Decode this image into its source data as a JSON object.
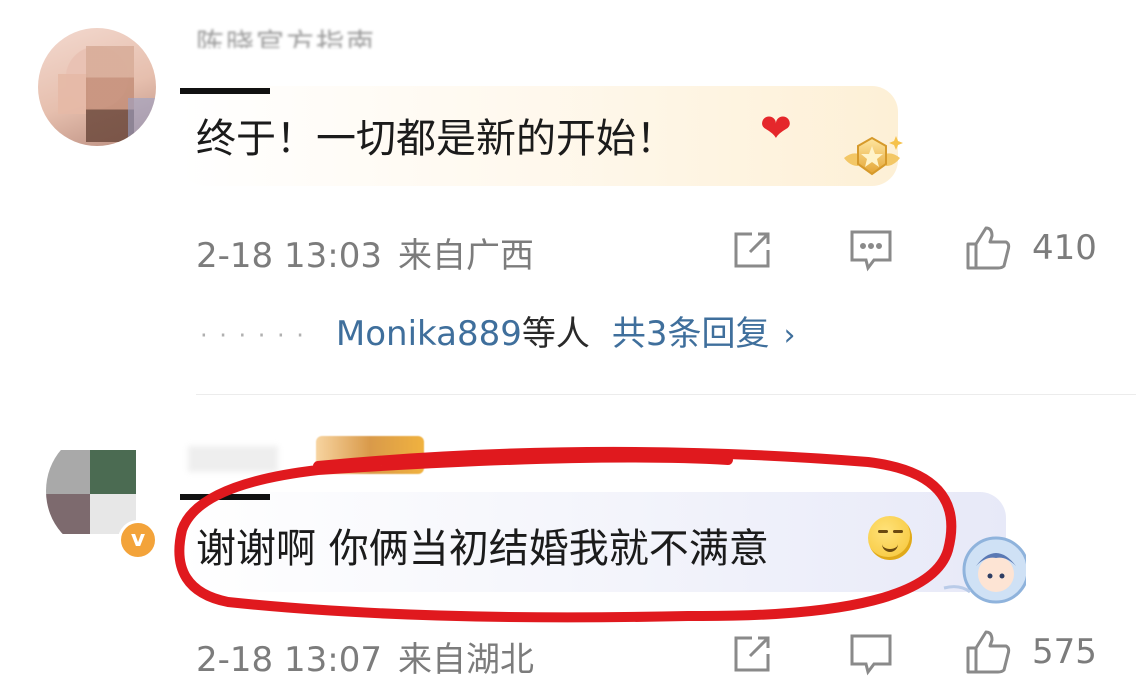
{
  "comments": [
    {
      "username": "陈晓官方指南",
      "text": "终于！一切都是新的开始！",
      "emoji": "red-heart",
      "date": "2-18 13:03",
      "location": "来自广西",
      "likes": "410",
      "replies": {
        "preview_user": "Monika889",
        "preview_suffix": "等人",
        "count_label": "共3条回复",
        "chevron": "›"
      }
    },
    {
      "text": "谢谢啊 你俩当初结婚我就不满意",
      "emoji": "smirk-face",
      "date": "2-18 13:07",
      "location": "来自湖北",
      "likes": "575",
      "verified_badge": "v"
    }
  ],
  "colors": {
    "link": "#3f6f9c",
    "meta": "#7c7c7c",
    "highlight_circle": "#e0191e"
  }
}
